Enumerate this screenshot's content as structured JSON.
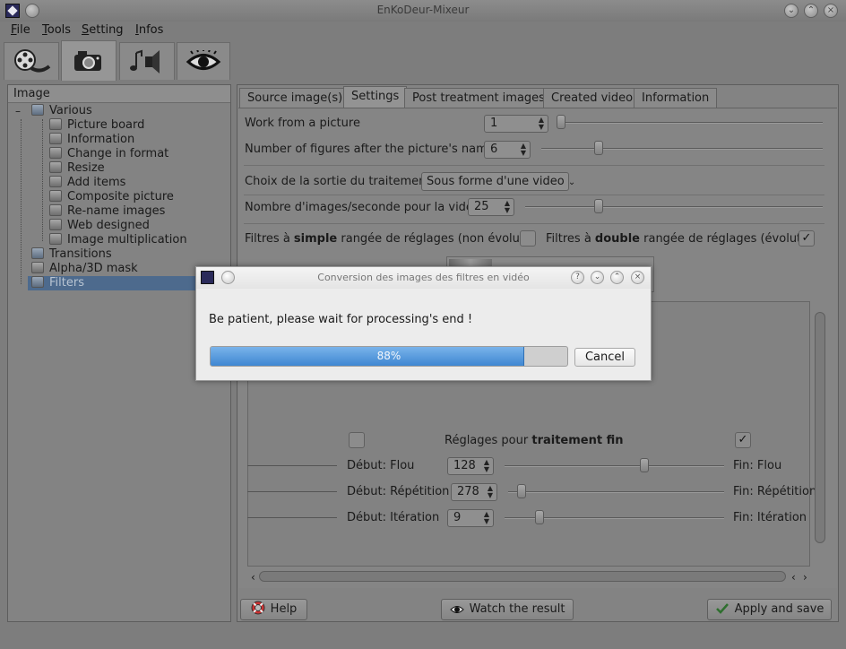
{
  "window": {
    "title": "EnKoDeur-Mixeur"
  },
  "menu": [
    {
      "label": "File"
    },
    {
      "label": "Tools"
    },
    {
      "label": "Setting"
    },
    {
      "label": "Infos"
    }
  ],
  "tool_tabs": [
    "film-reel-icon",
    "camera-icon",
    "music-speaker-icon",
    "eye-icon"
  ],
  "tree": {
    "header": "Image",
    "items": [
      {
        "label": "Various",
        "level": 0
      },
      {
        "label": "Picture board",
        "level": 1
      },
      {
        "label": "Information",
        "level": 1
      },
      {
        "label": "Change in format",
        "level": 1
      },
      {
        "label": "Resize",
        "level": 1
      },
      {
        "label": "Add items",
        "level": 1
      },
      {
        "label": "Composite picture",
        "level": 1
      },
      {
        "label": "Re-name images",
        "level": 1
      },
      {
        "label": "Web designed",
        "level": 1
      },
      {
        "label": "Image multiplication",
        "level": 1
      },
      {
        "label": "Transitions",
        "level": 0
      },
      {
        "label": "Alpha/3D mask",
        "level": 0
      },
      {
        "label": "Filters",
        "level": 0,
        "selected": true
      }
    ]
  },
  "tabs": [
    {
      "label": "Source image(s)"
    },
    {
      "label": "Settings",
      "active": true
    },
    {
      "label": "Post treatment images"
    },
    {
      "label": "Created video"
    },
    {
      "label": "Information"
    }
  ],
  "settings": {
    "work_from_picture": {
      "label": "Work from a picture",
      "value": "1",
      "slider": 0.0
    },
    "figures_after_name": {
      "label": "Number of figures after the picture's name",
      "value": "6",
      "slider": 0.2
    },
    "output_choice": {
      "label": "Choix de la sortie du traitement",
      "value": "Sous forme d'une video"
    },
    "fps": {
      "label": "Nombre d'images/seconde pour la vidéo",
      "value": "25",
      "slider": 0.25
    },
    "filter_simple": {
      "prefix": "Filtres à ",
      "bold": "simple",
      "suffix": " rangée de réglages (non évolutif)",
      "checked": false
    },
    "filter_double": {
      "prefix": "Filtres à ",
      "bold": "double",
      "suffix": " rangée de réglages (évolutif)",
      "checked": true
    },
    "fine": {
      "prefix": "Réglages pour ",
      "bold": "traitement fin",
      "left_checked": false,
      "right_checked": true
    },
    "rows": [
      {
        "start_label": "Début: Flou",
        "value": "128",
        "end_label": "Fin: Flou",
        "slider": 0.63
      },
      {
        "start_label": "Début: Répétition",
        "value": "278",
        "end_label": "Fin: Répétition",
        "slider": 0.04
      },
      {
        "start_label": "Début: Itération",
        "value": "9",
        "end_label": "Fin: Itération",
        "slider": 0.16
      }
    ]
  },
  "buttons": {
    "help": "Help",
    "watch": "Watch the result",
    "apply": "Apply and save"
  },
  "dialog": {
    "title": "Conversion des images des filtres en vidéo",
    "message": "Be patient, please wait for processing's end !",
    "progress": 88,
    "progress_text": "88%",
    "cancel": "Cancel"
  }
}
